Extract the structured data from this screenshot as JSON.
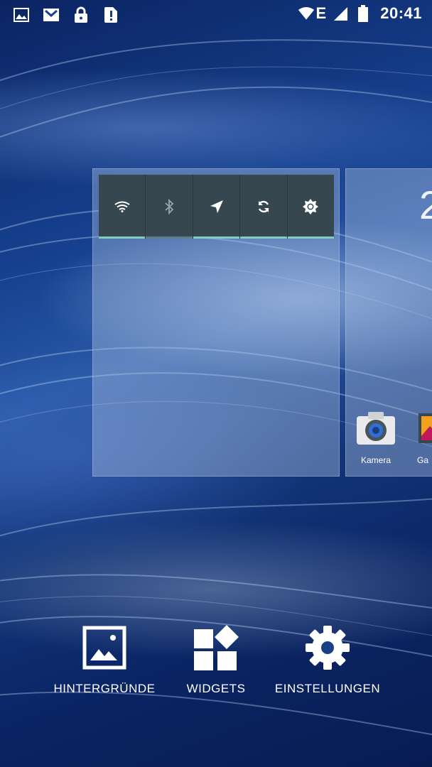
{
  "status_bar": {
    "time": "20:41",
    "network_type": "E",
    "notification_icons": [
      "image-notification-icon",
      "gmail-icon",
      "lock-icon",
      "alert-icon"
    ],
    "system_icons": [
      "wifi-icon",
      "signal-icon",
      "battery-icon"
    ]
  },
  "power_widget": {
    "buttons": [
      {
        "name": "wifi-toggle",
        "icon": "wifi-icon",
        "state": "on"
      },
      {
        "name": "bluetooth-toggle",
        "icon": "bluetooth-icon",
        "state": "off"
      },
      {
        "name": "location-toggle",
        "icon": "location-icon",
        "state": "on"
      },
      {
        "name": "sync-toggle",
        "icon": "sync-icon",
        "state": "on"
      },
      {
        "name": "brightness-toggle",
        "icon": "brightness-icon",
        "state": "on"
      }
    ]
  },
  "next_panel": {
    "clock_fragment": "2",
    "apps": [
      {
        "label": "Kamera",
        "icon": "camera-icon"
      },
      {
        "label": "Ga",
        "icon": "gallery-icon"
      }
    ]
  },
  "options": {
    "wallpapers_label": "HINTERGRÜNDE",
    "widgets_label": "WIDGETS",
    "settings_label": "EINSTELLUNGEN"
  },
  "colors": {
    "widget_bg": "#37474f",
    "indicator_on": "#80cbc4",
    "indicator_off": "#607d8b"
  }
}
